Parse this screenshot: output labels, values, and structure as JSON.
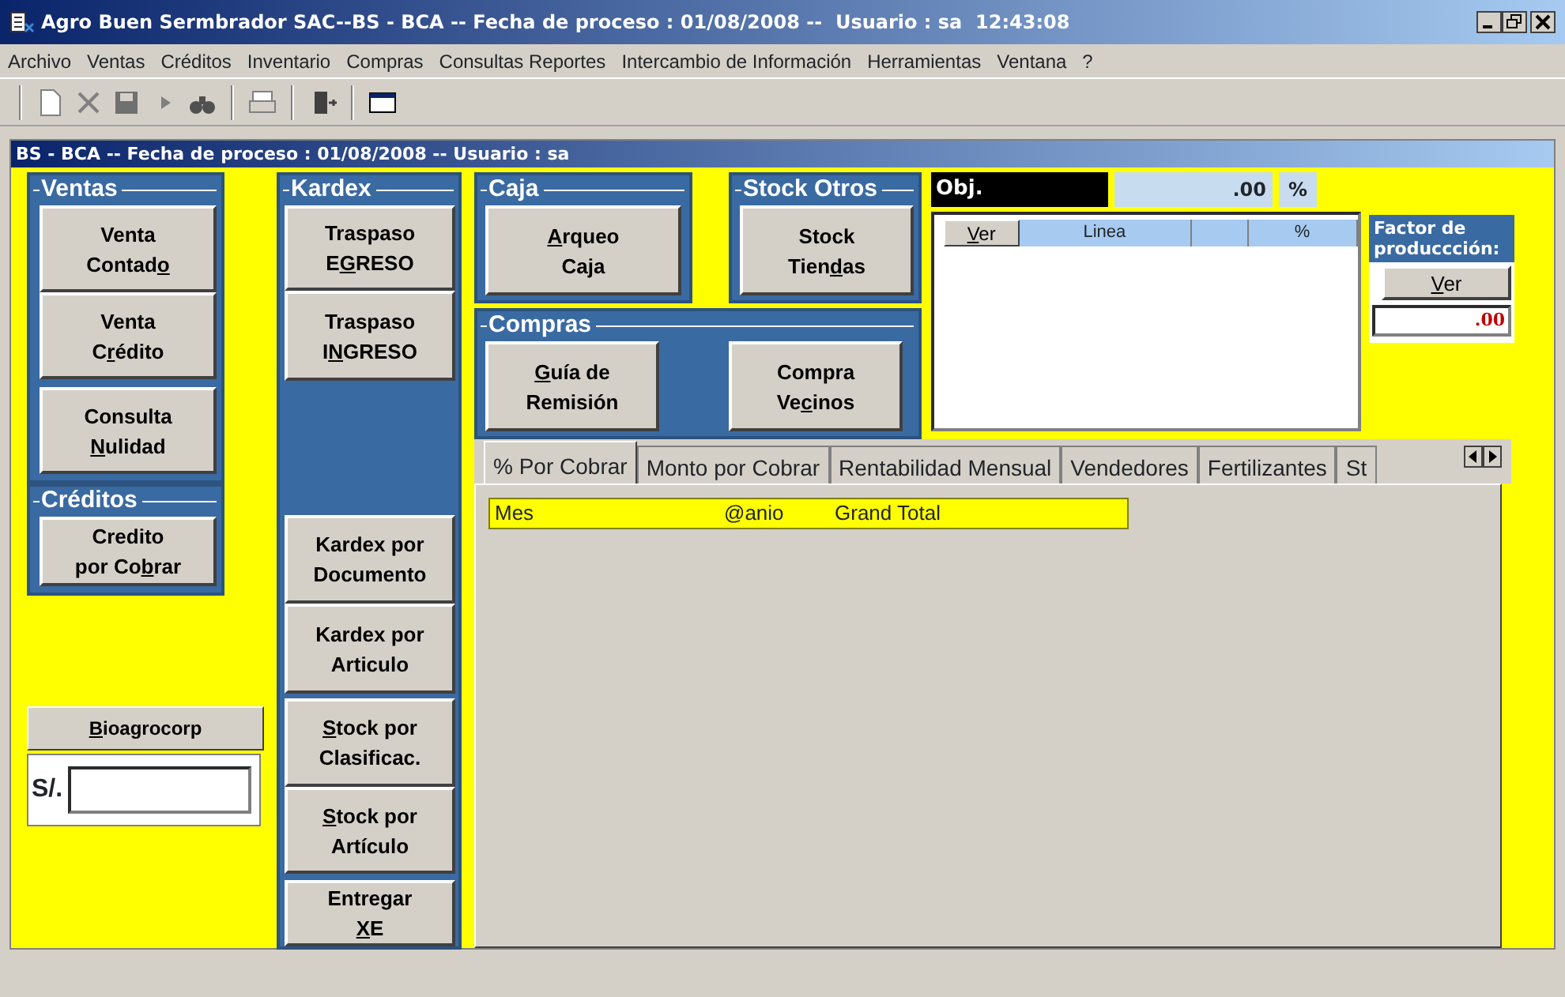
{
  "window": {
    "title": "Agro Buen Sermbrador SAC--BS - BCA -- Fecha de proceso : 01/08/2008 --  Usuario : sa  12:43:08"
  },
  "menu": [
    "Archivo",
    "Ventas",
    "Créditos",
    "Inventario",
    "Compras",
    "Consultas Reportes",
    "Intercambio de Información",
    "Herramientas",
    "Ventana",
    "?"
  ],
  "child_window": {
    "title": "BS - BCA -- Fecha de proceso : 01/08/2008 --  Usuario : sa"
  },
  "ventas": {
    "title": "Ventas",
    "buttons": [
      {
        "label": "Venta\nContad",
        "key": "o"
      },
      {
        "label": "Venta\nC",
        "key": "r",
        "rest": "édito"
      },
      {
        "label": "Consulta\n",
        "key": "N",
        "rest": "ulidad"
      }
    ]
  },
  "creditos": {
    "title": "Créditos",
    "buttons": [
      {
        "label": "Credito\npor Co",
        "key": "b",
        "rest": "rar"
      }
    ]
  },
  "kardex": {
    "title": "Kardex",
    "buttons": [
      {
        "label": "Traspaso\nE",
        "key": "G",
        "rest": "RESO"
      },
      {
        "label": "Traspaso\nI",
        "key": "N",
        "rest": "GRESO"
      },
      {
        "label": "Kardex por\nDocumento"
      },
      {
        "label": "Kardex por\nArticulo"
      },
      {
        "key": "S",
        "rest": "tock por\nClasificac."
      },
      {
        "key": "S",
        "rest": "tock por\nArtículo"
      },
      {
        "label": "Entregar\n",
        "key": "X",
        "rest": "E"
      }
    ]
  },
  "caja": {
    "title": "Caja",
    "buttons": [
      {
        "key": "A",
        "rest": "rqueo\nCaja"
      }
    ]
  },
  "stock_otros": {
    "title": "Stock Otros",
    "buttons": [
      {
        "label": "Stock\nTien",
        "key": "d",
        "rest": "as"
      }
    ]
  },
  "compras": {
    "title": "Compras",
    "buttons": [
      {
        "key": "G",
        "rest": "uía de\nRemisión"
      },
      {
        "label": "Compra\nVe",
        "key": "c",
        "rest": "inos"
      }
    ]
  },
  "bioagrocorp": {
    "button": {
      "key": "B",
      "rest": "ioagrocorp"
    },
    "currency": "S/."
  },
  "objective": {
    "label": "Obj.",
    "value": ".00",
    "unit": "%"
  },
  "lines_grid": {
    "button": {
      "key": "V",
      "rest": "er"
    },
    "columns": [
      {
        "kind": "title",
        "title": "Linea"
      },
      {
        "kind": "blank"
      },
      {
        "kind": "title",
        "title": "%"
      }
    ]
  },
  "factor": {
    "title": "Factor de produccción:",
    "button": {
      "key": "V",
      "rest": "er"
    },
    "value": ".00"
  },
  "tabs": [
    {
      "label": "% Por Cobrar",
      "selected": true
    },
    {
      "label": "Monto por Cobrar",
      "selected": false
    },
    {
      "label": "Rentabilidad Mensual",
      "selected": false
    },
    {
      "label": "Vendedores",
      "selected": false
    },
    {
      "label": "Fertilizantes",
      "selected": false
    },
    {
      "label": "St",
      "selected": false
    }
  ],
  "pivot": {
    "columns": [
      "Mes",
      "@anio",
      "Grand Total"
    ]
  }
}
